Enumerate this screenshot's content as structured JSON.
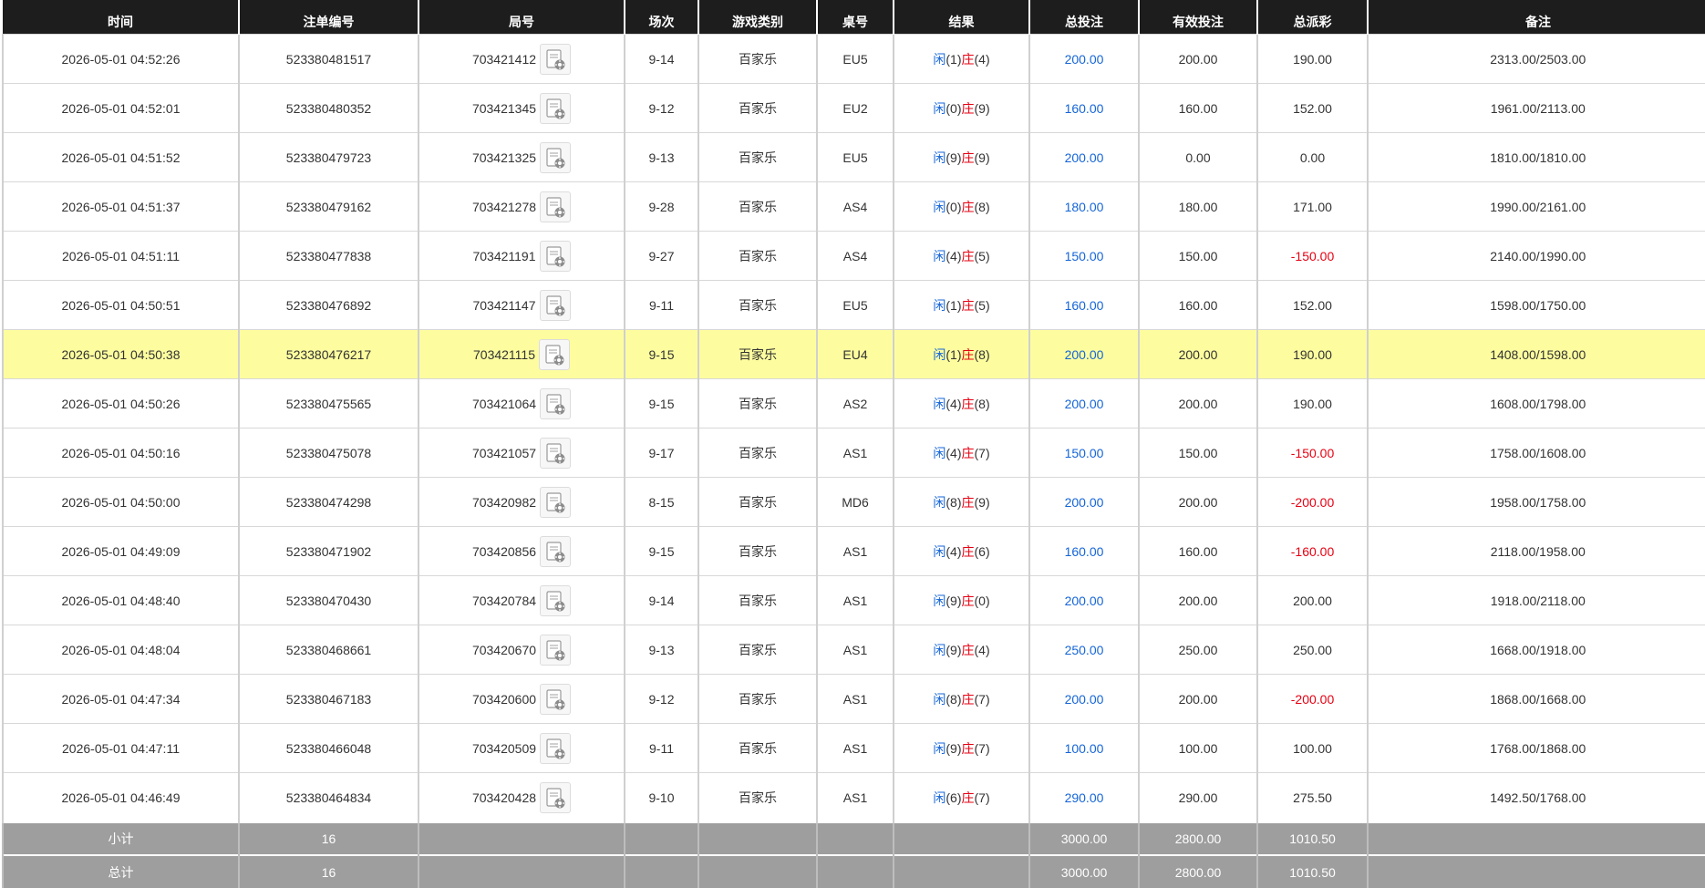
{
  "columns": [
    "时间",
    "注单编号",
    "局号",
    "场次",
    "游戏类别",
    "桌号",
    "结果",
    "总投注",
    "有效投注",
    "总派彩",
    "备注"
  ],
  "result_labels": {
    "player": "闲",
    "banker": "庄"
  },
  "colors": {
    "header_bg": "#1d1d1d",
    "highlight_row": "#fdfd9f",
    "bet_blue": "#1565d8",
    "loss_red": "#e60012",
    "footer_bg": "#9e9e9e"
  },
  "rows": [
    {
      "time": "2026-05-01 04:52:26",
      "bet_no": "523380481517",
      "round_no": "703421412",
      "shoe": "9-14",
      "game": "百家乐",
      "table": "EU5",
      "player": "(1)",
      "banker": "(4)",
      "total_bet": "200.00",
      "valid_bet": "200.00",
      "payout": "190.00",
      "payout_negative": false,
      "note": "2313.00/2503.00",
      "highlighted": false,
      "round_icon": "replay-icon"
    },
    {
      "time": "2026-05-01 04:52:01",
      "bet_no": "523380480352",
      "round_no": "703421345",
      "shoe": "9-12",
      "game": "百家乐",
      "table": "EU2",
      "player": "(0)",
      "banker": "(9)",
      "total_bet": "160.00",
      "valid_bet": "160.00",
      "payout": "152.00",
      "payout_negative": false,
      "note": "1961.00/2113.00",
      "highlighted": false,
      "round_icon": "replay-icon"
    },
    {
      "time": "2026-05-01 04:51:52",
      "bet_no": "523380479723",
      "round_no": "703421325",
      "shoe": "9-13",
      "game": "百家乐",
      "table": "EU5",
      "player": "(9)",
      "banker": "(9)",
      "total_bet": "200.00",
      "valid_bet": "0.00",
      "payout": "0.00",
      "payout_negative": false,
      "note": "1810.00/1810.00",
      "highlighted": false,
      "round_icon": "replay-icon"
    },
    {
      "time": "2026-05-01 04:51:37",
      "bet_no": "523380479162",
      "round_no": "703421278",
      "shoe": "9-28",
      "game": "百家乐",
      "table": "AS4",
      "player": "(0)",
      "banker": "(8)",
      "total_bet": "180.00",
      "valid_bet": "180.00",
      "payout": "171.00",
      "payout_negative": false,
      "note": "1990.00/2161.00",
      "highlighted": false,
      "round_icon": "replay-icon"
    },
    {
      "time": "2026-05-01 04:51:11",
      "bet_no": "523380477838",
      "round_no": "703421191",
      "shoe": "9-27",
      "game": "百家乐",
      "table": "AS4",
      "player": "(4)",
      "banker": "(5)",
      "total_bet": "150.00",
      "valid_bet": "150.00",
      "payout": "-150.00",
      "payout_negative": true,
      "note": "2140.00/1990.00",
      "highlighted": false,
      "round_icon": "replay-icon"
    },
    {
      "time": "2026-05-01 04:50:51",
      "bet_no": "523380476892",
      "round_no": "703421147",
      "shoe": "9-11",
      "game": "百家乐",
      "table": "EU5",
      "player": "(1)",
      "banker": "(5)",
      "total_bet": "160.00",
      "valid_bet": "160.00",
      "payout": "152.00",
      "payout_negative": false,
      "note": "1598.00/1750.00",
      "highlighted": false,
      "round_icon": "replay-icon"
    },
    {
      "time": "2026-05-01 04:50:38",
      "bet_no": "523380476217",
      "round_no": "703421115",
      "shoe": "9-15",
      "game": "百家乐",
      "table": "EU4",
      "player": "(1)",
      "banker": "(8)",
      "total_bet": "200.00",
      "valid_bet": "200.00",
      "payout": "190.00",
      "payout_negative": false,
      "note": "1408.00/1598.00",
      "highlighted": true,
      "round_icon": "replay-icon"
    },
    {
      "time": "2026-05-01 04:50:26",
      "bet_no": "523380475565",
      "round_no": "703421064",
      "shoe": "9-15",
      "game": "百家乐",
      "table": "AS2",
      "player": "(4)",
      "banker": "(8)",
      "total_bet": "200.00",
      "valid_bet": "200.00",
      "payout": "190.00",
      "payout_negative": false,
      "note": "1608.00/1798.00",
      "highlighted": false,
      "round_icon": "replay-icon"
    },
    {
      "time": "2026-05-01 04:50:16",
      "bet_no": "523380475078",
      "round_no": "703421057",
      "shoe": "9-17",
      "game": "百家乐",
      "table": "AS1",
      "player": "(4)",
      "banker": "(7)",
      "total_bet": "150.00",
      "valid_bet": "150.00",
      "payout": "-150.00",
      "payout_negative": true,
      "note": "1758.00/1608.00",
      "highlighted": false,
      "round_icon": "replay-icon"
    },
    {
      "time": "2026-05-01 04:50:00",
      "bet_no": "523380474298",
      "round_no": "703420982",
      "shoe": "8-15",
      "game": "百家乐",
      "table": "MD6",
      "player": "(8)",
      "banker": "(9)",
      "total_bet": "200.00",
      "valid_bet": "200.00",
      "payout": "-200.00",
      "payout_negative": true,
      "note": "1958.00/1758.00",
      "highlighted": false,
      "round_icon": "replay-icon"
    },
    {
      "time": "2026-05-01 04:49:09",
      "bet_no": "523380471902",
      "round_no": "703420856",
      "shoe": "9-15",
      "game": "百家乐",
      "table": "AS1",
      "player": "(4)",
      "banker": "(6)",
      "total_bet": "160.00",
      "valid_bet": "160.00",
      "payout": "-160.00",
      "payout_negative": true,
      "note": "2118.00/1958.00",
      "highlighted": false,
      "round_icon": "replay-icon"
    },
    {
      "time": "2026-05-01 04:48:40",
      "bet_no": "523380470430",
      "round_no": "703420784",
      "shoe": "9-14",
      "game": "百家乐",
      "table": "AS1",
      "player": "(9)",
      "banker": "(0)",
      "total_bet": "200.00",
      "valid_bet": "200.00",
      "payout": "200.00",
      "payout_negative": false,
      "note": "1918.00/2118.00",
      "highlighted": false,
      "round_icon": "replay-icon"
    },
    {
      "time": "2026-05-01 04:48:04",
      "bet_no": "523380468661",
      "round_no": "703420670",
      "shoe": "9-13",
      "game": "百家乐",
      "table": "AS1",
      "player": "(9)",
      "banker": "(4)",
      "total_bet": "250.00",
      "valid_bet": "250.00",
      "payout": "250.00",
      "payout_negative": false,
      "note": "1668.00/1918.00",
      "highlighted": false,
      "round_icon": "replay-icon"
    },
    {
      "time": "2026-05-01 04:47:34",
      "bet_no": "523380467183",
      "round_no": "703420600",
      "shoe": "9-12",
      "game": "百家乐",
      "table": "AS1",
      "player": "(8)",
      "banker": "(7)",
      "total_bet": "200.00",
      "valid_bet": "200.00",
      "payout": "-200.00",
      "payout_negative": true,
      "note": "1868.00/1668.00",
      "highlighted": false,
      "round_icon": "replay-icon"
    },
    {
      "time": "2026-05-01 04:47:11",
      "bet_no": "523380466048",
      "round_no": "703420509",
      "shoe": "9-11",
      "game": "百家乐",
      "table": "AS1",
      "player": "(9)",
      "banker": "(7)",
      "total_bet": "100.00",
      "valid_bet": "100.00",
      "payout": "100.00",
      "payout_negative": false,
      "note": "1768.00/1868.00",
      "highlighted": false,
      "round_icon": "replay-icon"
    },
    {
      "time": "2026-05-01 04:46:49",
      "bet_no": "523380464834",
      "round_no": "703420428",
      "shoe": "9-10",
      "game": "百家乐",
      "table": "AS1",
      "player": "(6)",
      "banker": "(7)",
      "total_bet": "290.00",
      "valid_bet": "290.00",
      "payout": "275.50",
      "payout_negative": false,
      "note": "1492.50/1768.00",
      "highlighted": false,
      "round_icon": "replay-icon"
    }
  ],
  "subtotal": {
    "label": "小计",
    "count": "16",
    "total_bet": "3000.00",
    "valid_bet": "2800.00",
    "payout": "1010.50"
  },
  "total": {
    "label": "总计",
    "count": "16",
    "total_bet": "3000.00",
    "valid_bet": "2800.00",
    "payout": "1010.50"
  }
}
